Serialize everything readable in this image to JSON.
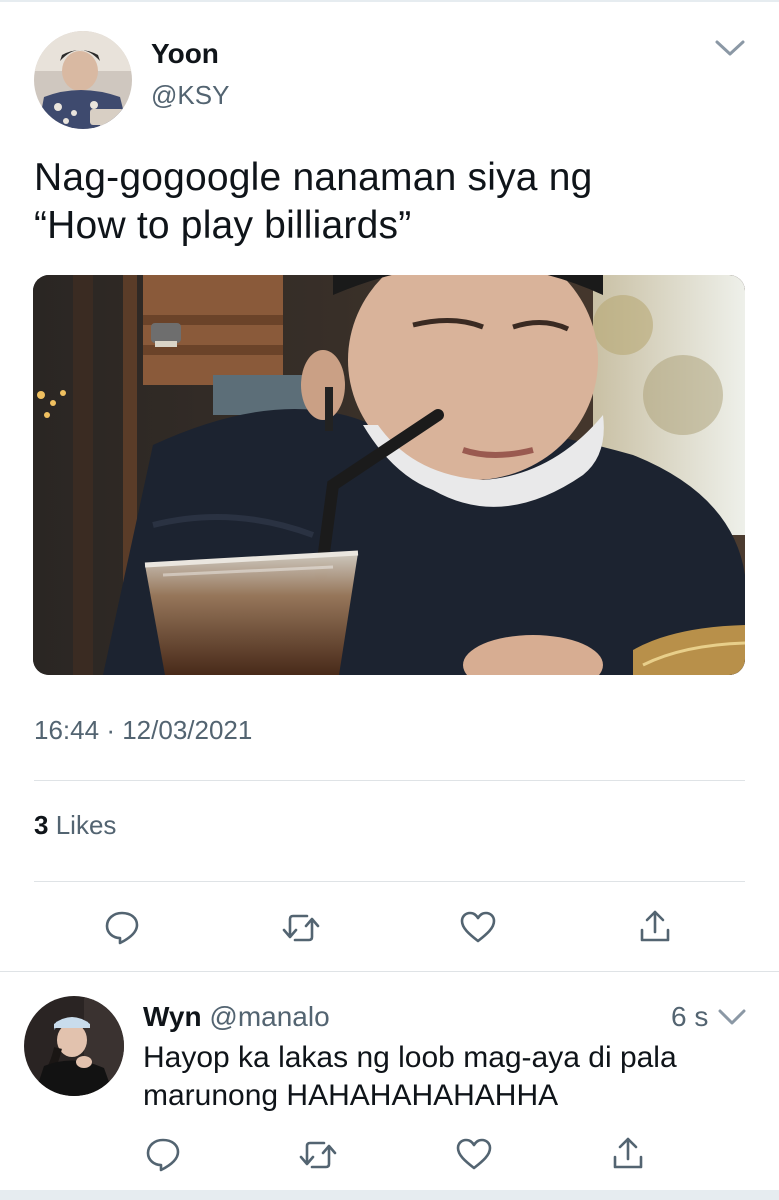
{
  "tweet": {
    "author_name": "Yoon",
    "author_handle": "@KSY",
    "text_line1": "Nag-gogoogle nanaman siya ng",
    "text_line2": "“How to play billiards”",
    "time": "16:44",
    "separator": "·",
    "date": "12/03/2021",
    "likes_count": "3",
    "likes_label": "Likes",
    "actions": [
      "reply-icon",
      "retweet-icon",
      "like-icon",
      "share-icon"
    ]
  },
  "reply": {
    "author_name": "Wyn",
    "author_handle": "@manalo",
    "time_ago": "6 s",
    "text_line1": "Hayop ka lakas ng loob mag-aya di pala",
    "text_line2": "marunong HAHAHAHAHAHHA",
    "actions": [
      "reply-icon",
      "retweet-icon",
      "like-icon",
      "share-icon"
    ]
  },
  "colors": {
    "text": "#0f1419",
    "muted": "#536471",
    "divider": "#dfe3e6",
    "icon": "#536471"
  }
}
